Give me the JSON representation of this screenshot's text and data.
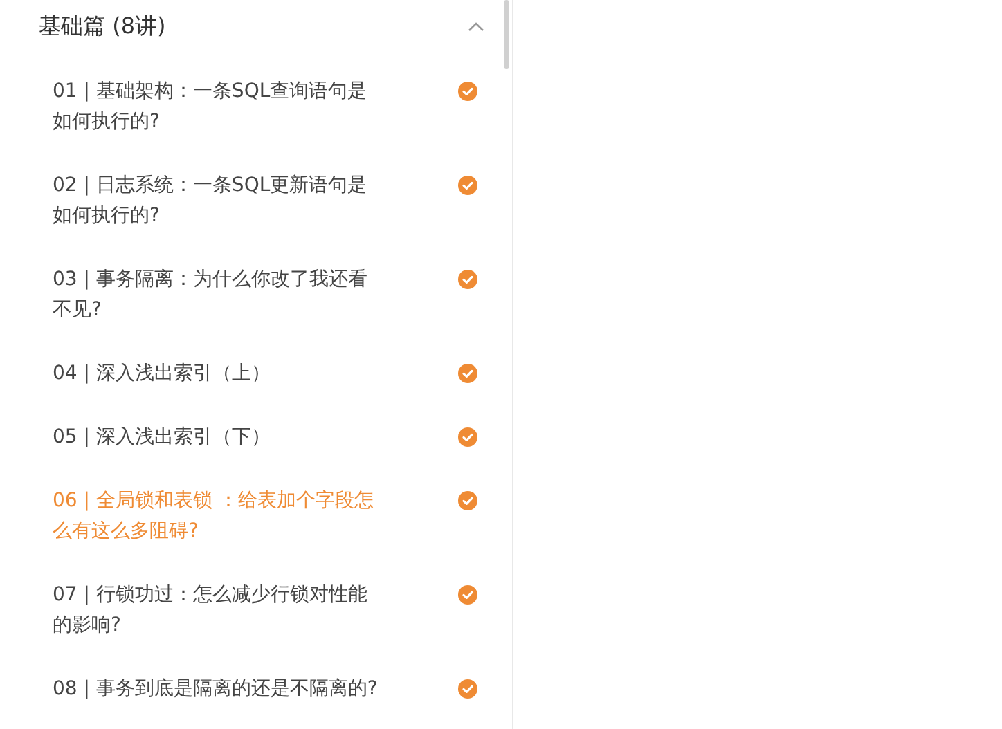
{
  "section": {
    "title": "基础篇 (8讲)",
    "expanded": true
  },
  "lessons": [
    {
      "title": "01 | 基础架构：一条SQL查询语句是如何执行的?",
      "completed": true,
      "selected": false
    },
    {
      "title": "02 | 日志系统：一条SQL更新语句是如何执行的?",
      "completed": true,
      "selected": false
    },
    {
      "title": "03 | 事务隔离：为什么你改了我还看不见?",
      "completed": true,
      "selected": false
    },
    {
      "title": "04 | 深入浅出索引（上）",
      "completed": true,
      "selected": false
    },
    {
      "title": "05 | 深入浅出索引（下）",
      "completed": true,
      "selected": false
    },
    {
      "title": "06 | 全局锁和表锁 ：给表加个字段怎么有这么多阻碍?",
      "completed": true,
      "selected": true
    },
    {
      "title": "07 | 行锁功过：怎么减少行锁对性能的影响?",
      "completed": true,
      "selected": false
    },
    {
      "title": "08 | 事务到底是隔离的还是不隔离的?",
      "completed": true,
      "selected": false
    }
  ]
}
